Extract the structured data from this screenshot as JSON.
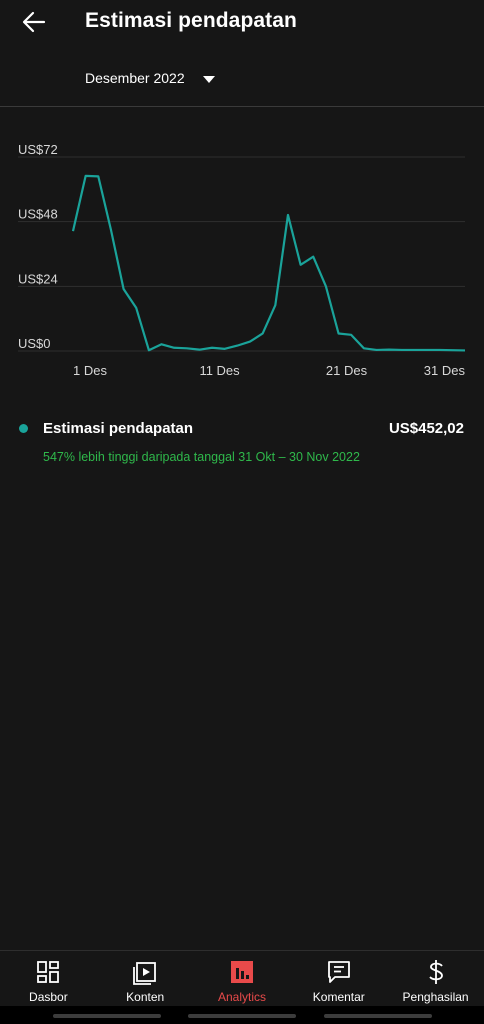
{
  "header": {
    "title": "Estimasi pendapatan",
    "period_label": "Desember 2022"
  },
  "chart_data": {
    "type": "line",
    "title": "",
    "xlabel": "",
    "ylabel": "",
    "x_ticks": [
      "1 Des",
      "11 Des",
      "21 Des",
      "31 Des"
    ],
    "y_ticks": [
      "US$0",
      "US$24",
      "US$48",
      "US$72"
    ],
    "ylim": [
      0,
      72
    ],
    "grid": true,
    "x": [
      0,
      1,
      2,
      3,
      4,
      5,
      6,
      7,
      8,
      9,
      10,
      11,
      12,
      13,
      14,
      15,
      16,
      17,
      18,
      19,
      20,
      21,
      22,
      23,
      24,
      25,
      26,
      27,
      28,
      29,
      30,
      31
    ],
    "series": [
      {
        "values": [
          44.5,
          65,
          64.8,
          45,
          23,
          16,
          0.3,
          2.5,
          1.2,
          1,
          0.5,
          1.2,
          0.8,
          2,
          3.5,
          6.5,
          17,
          50.5,
          32,
          35,
          24,
          6.5,
          6,
          1,
          0.4,
          0.5,
          0.4,
          0.4,
          0.4,
          0.4,
          0.3,
          0.2
        ],
        "color": "#1aa39a"
      }
    ]
  },
  "summary": {
    "metric_label": "Estimasi pendapatan",
    "total": "US$452,02",
    "comparison": "547% lebih tinggi daripada tanggal 31 Okt – 30 Nov 2022",
    "comparison_color": "#2fb84b"
  },
  "nav": [
    {
      "label": "Dasbor",
      "icon": "dashboard-icon"
    },
    {
      "label": "Konten",
      "icon": "content-icon"
    },
    {
      "label": "Analytics",
      "icon": "analytics-icon"
    },
    {
      "label": "Komentar",
      "icon": "comments-icon"
    },
    {
      "label": "Penghasilan",
      "icon": "dollar-icon"
    }
  ],
  "colors": {
    "accent": "#e84a4a",
    "line": "#1aa39a",
    "background": "#161616"
  }
}
